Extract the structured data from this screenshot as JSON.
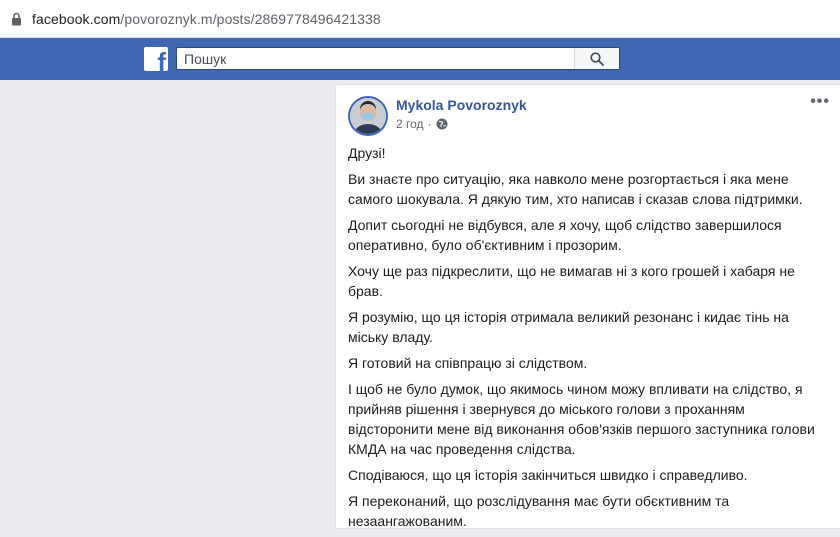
{
  "browser": {
    "url_host": "facebook.com",
    "url_path": "/povoroznyk.m/posts/2869778496421338"
  },
  "fb": {
    "logo_letter": "f",
    "search_placeholder": "Пошук"
  },
  "post": {
    "author": "Mykola Povoroznyk",
    "time": "2 год",
    "dot": "·",
    "more": "•••",
    "paragraphs": [
      "Друзі!",
      "Ви знаєте про ситуацію, яка навколо мене розгортається і яка мене самого шокувала. Я дякую тим, хто написав і сказав слова підтримки.",
      "Допит сьогодні не відбувся, але я хочу, щоб слідство завершилося оперативно, було об'єктивним і прозорим.",
      "Хочу ще раз підкреслити, що не вимагав ні з кого грошей і хабаря не брав.",
      "Я розумію, що ця історія отримала великий резонанс і кидає тінь на міську владу.",
      "Я готовий на співпрацю зі слідством.",
      "І щоб не було думок, що якимось чином можу впливати на слідство, я прийняв рішення і звернувся до міського голови з проханням відсторонити мене від виконання обов'язків першого заступника голови КМДА на час проведення слідства.",
      "Сподіваюся, що ця історія закінчиться швидко і справедливо.",
      "Я переконаний, що розслідування має бути обєктивним та незаангажованим."
    ]
  },
  "colors": {
    "fb_blue": "#4267b2",
    "link": "#385898",
    "page_bg": "#e9ebee"
  }
}
